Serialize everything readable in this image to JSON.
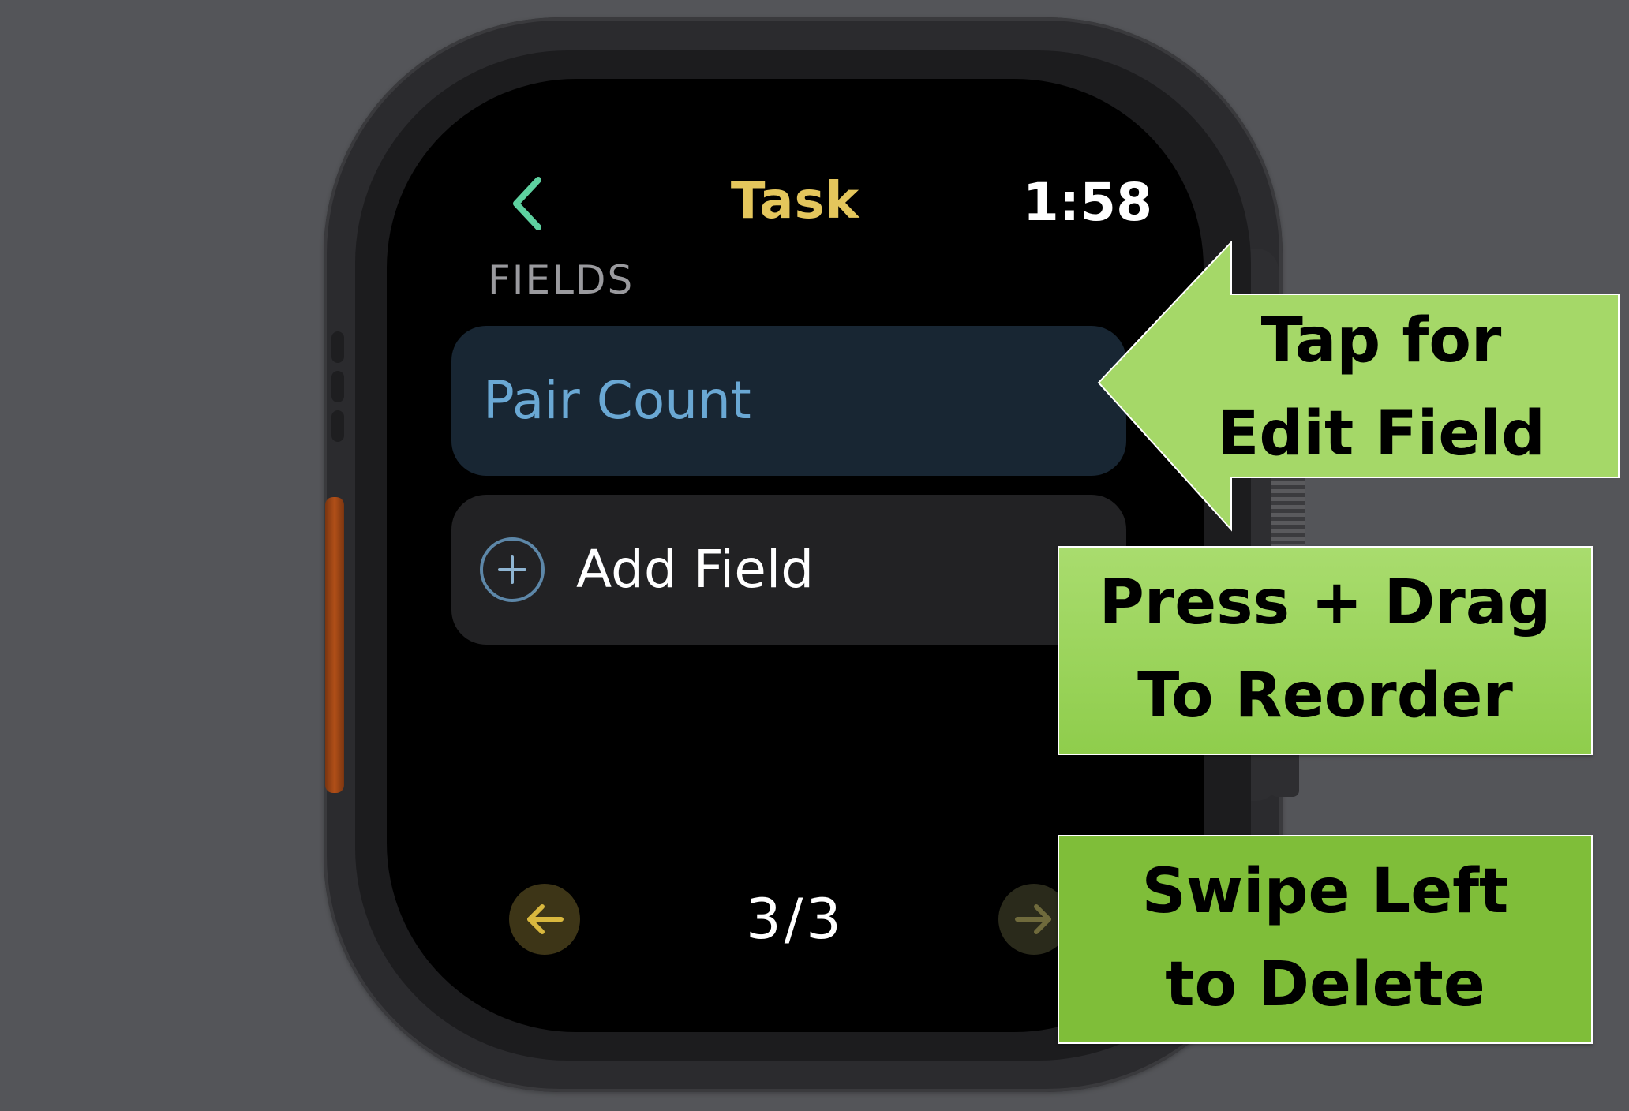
{
  "screen": {
    "title": "Task",
    "time": "1:58",
    "section_label": "FIELDS",
    "fields": [
      {
        "label": "Pair Count"
      }
    ],
    "add_field_label": "Add Field",
    "page_indicator": "3/3",
    "icons": {
      "back": "chevron-left-icon",
      "add": "plus-circle-icon",
      "prev": "arrow-left-icon",
      "next": "arrow-right-icon"
    }
  },
  "callouts": {
    "edit": {
      "line1": "Tap for",
      "line2": "Edit Field"
    },
    "reorder": {
      "line1": "Press + Drag",
      "line2": "To Reorder"
    },
    "delete": {
      "line1": "Swipe Left",
      "line2": "to Delete"
    }
  },
  "colors": {
    "title": "#e4c65c",
    "field_text": "#6aa8d4",
    "back_chevron": "#5ed1a0",
    "callout_light": "#a9dc6e",
    "callout_dark": "#7fbe39",
    "action_button": "#b14f18"
  }
}
